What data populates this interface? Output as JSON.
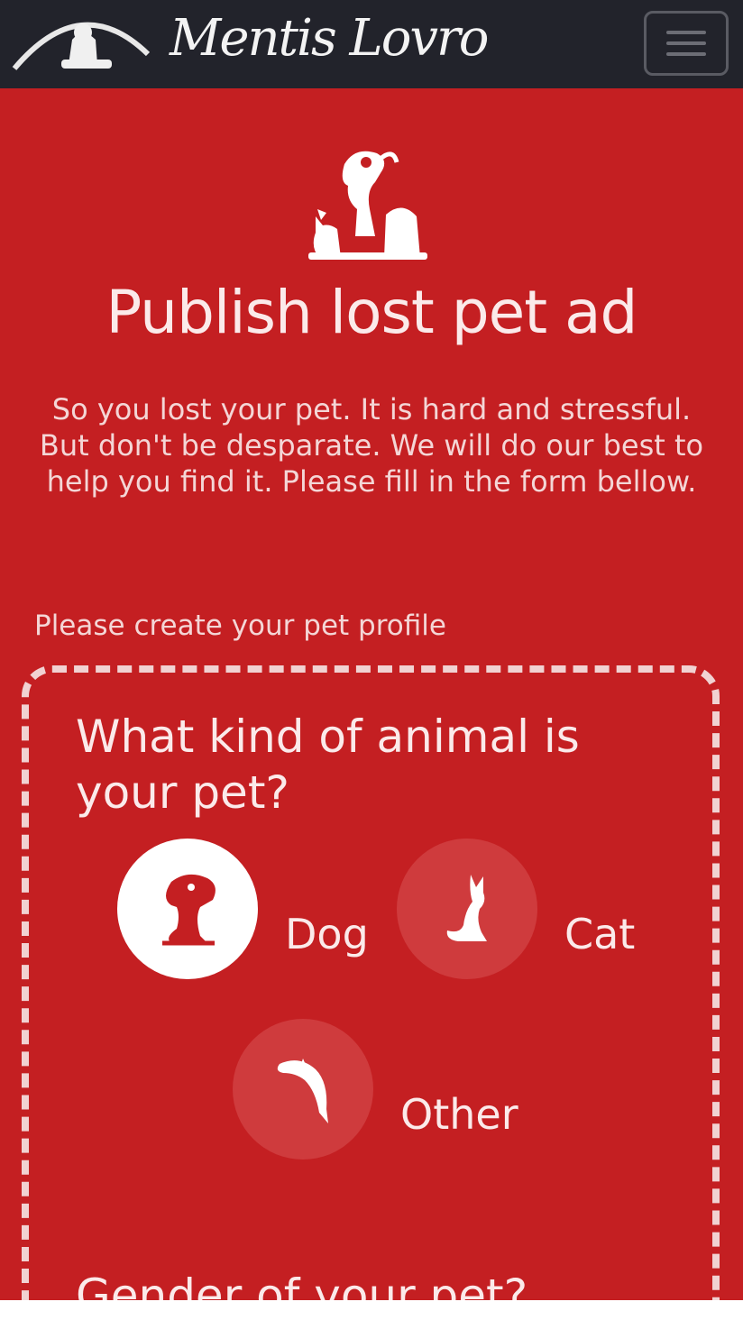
{
  "header": {
    "logo_text": "Mentis Lovro",
    "menu_icon": "hamburger-menu-icon"
  },
  "hero": {
    "icon": "pets-group-icon",
    "title": "Publish lost pet ad",
    "description": "So you lost your pet. It is hard and stressful. But don't be desparate. We will do our best to help you find it. Please fill in the form bellow."
  },
  "profile": {
    "label": "Please create your pet profile",
    "question": "What kind of animal is your pet?",
    "options": [
      {
        "label": "Dog",
        "icon": "dog-icon",
        "selected": true
      },
      {
        "label": "Cat",
        "icon": "cat-icon",
        "selected": false
      },
      {
        "label": "Other",
        "icon": "dolphin-icon",
        "selected": false
      }
    ],
    "next_question": "Gender of your pet?"
  },
  "colors": {
    "header_bg": "#22232b",
    "page_bg": "#c41f22",
    "text_light": "#fbeaea"
  }
}
